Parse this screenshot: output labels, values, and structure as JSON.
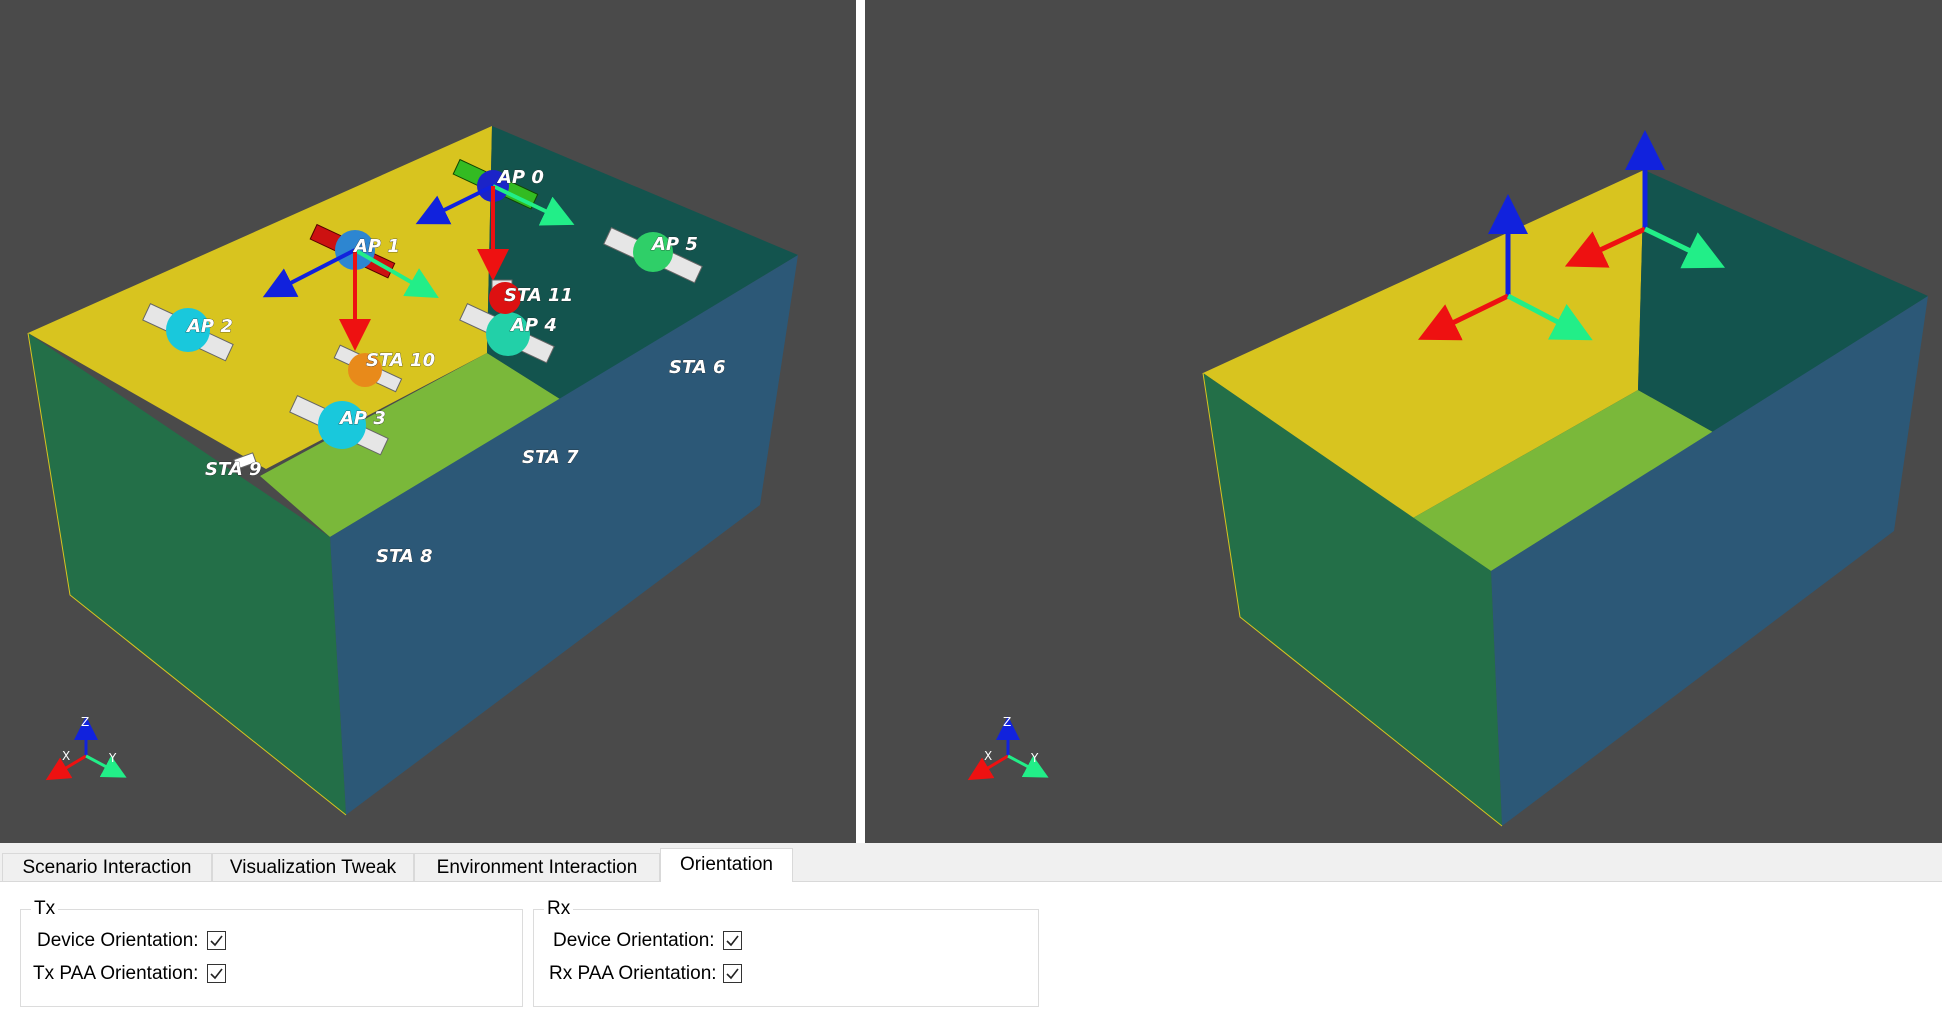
{
  "left_view": {
    "labels": {
      "ap0": "AP 0",
      "ap1": "AP 1",
      "ap2": "AP 2",
      "ap3": "AP 3",
      "ap4": "AP 4",
      "ap5": "AP 5",
      "sta6": "STA 6",
      "sta7": "STA 7",
      "sta8": "STA 8",
      "sta9": "STA 9",
      "sta10": "STA 10",
      "sta11": "STA 11"
    },
    "axes_widget": {
      "x": "X",
      "y": "Y",
      "z": "Z"
    }
  },
  "right_view": {
    "axes_widget": {
      "x": "X",
      "y": "Y",
      "z": "Z"
    }
  },
  "tabs": [
    {
      "label": "Scenario Interaction",
      "active": false
    },
    {
      "label": "Visualization Tweak",
      "active": false
    },
    {
      "label": "Environment Interaction",
      "active": false
    },
    {
      "label": "Orientation",
      "active": true
    }
  ],
  "tx_group": {
    "title": "Tx",
    "device_orientation_label": "Device Orientation:",
    "device_orientation_checked": true,
    "paa_orientation_label": "Tx PAA Orientation:",
    "paa_orientation_checked": true
  },
  "rx_group": {
    "title": "Rx",
    "device_orientation_label": "Device Orientation:",
    "device_orientation_checked": true,
    "paa_orientation_label": "Rx PAA Orientation:",
    "paa_orientation_checked": true
  },
  "colors": {
    "background_3d": "#4a4a4a",
    "wall_yellow": "#d8c41f",
    "floor_green": "#7ab83a",
    "wall_teal": "#13544e",
    "wall_blue": "#2c5877",
    "wall_green": "#236f48",
    "axis_red": "#ee1111",
    "axis_blue": "#1122dd",
    "axis_green": "#22ee88"
  }
}
